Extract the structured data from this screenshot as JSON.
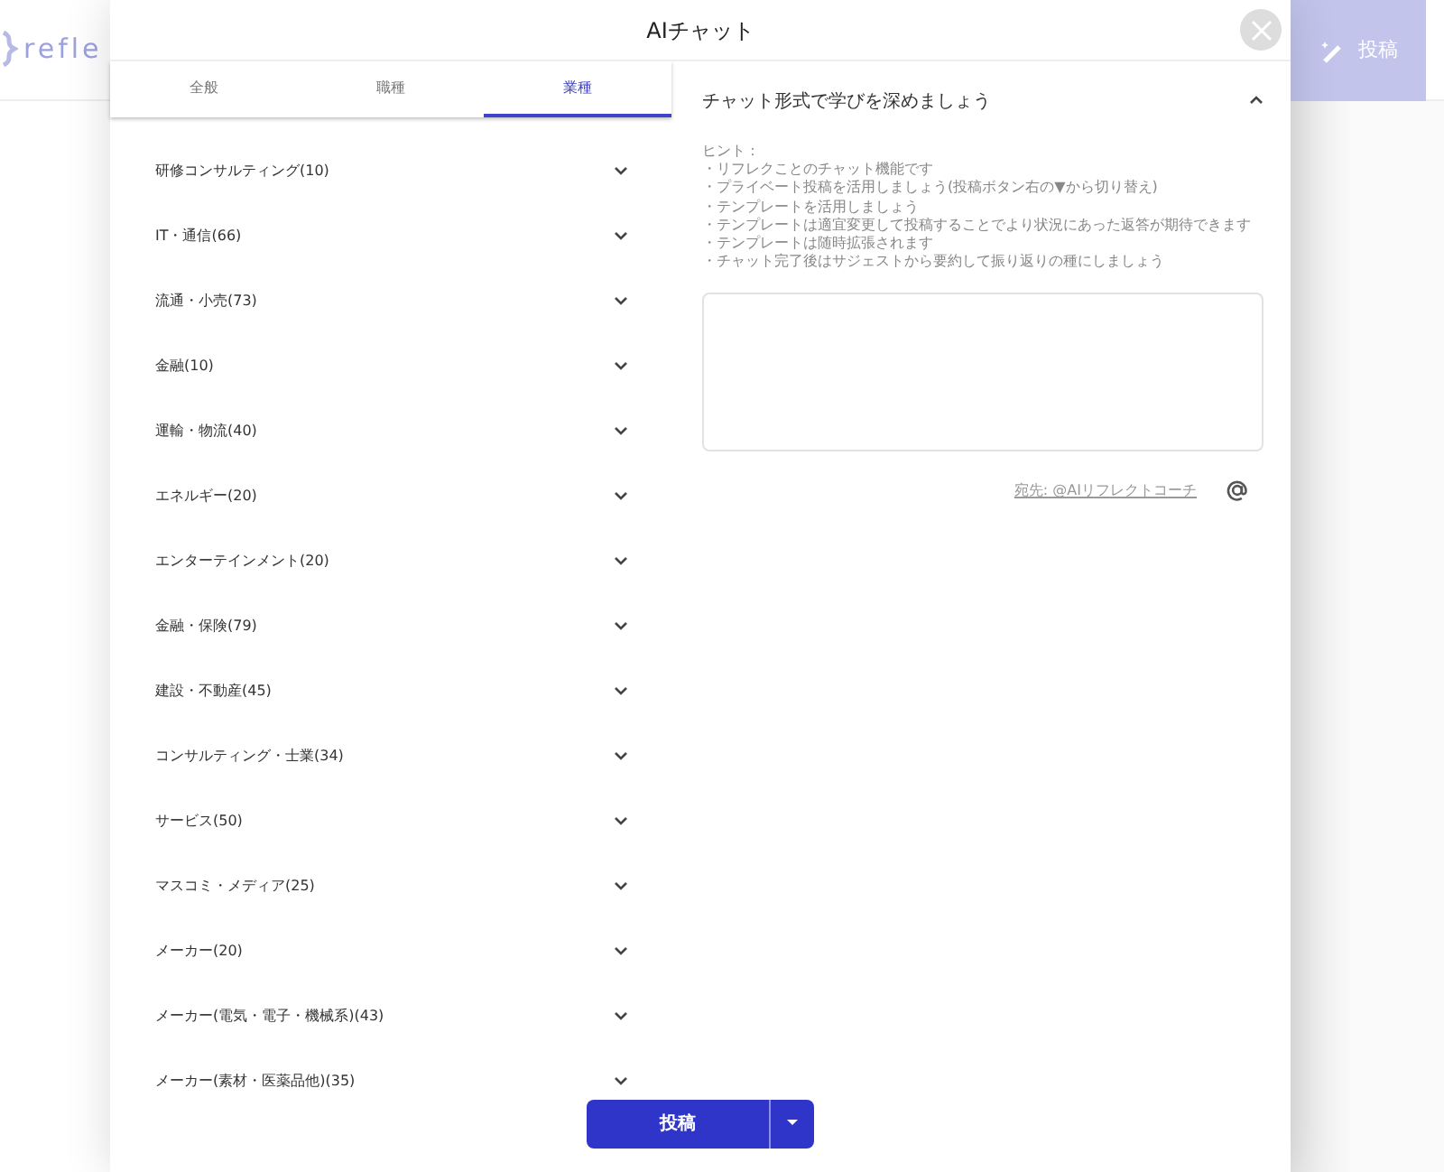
{
  "background": {
    "logo_text": "refle",
    "post_button": "投稿"
  },
  "modal": {
    "title": "AIチャット"
  },
  "tabs": [
    {
      "label": "全般",
      "selected": false
    },
    {
      "label": "職種",
      "selected": false
    },
    {
      "label": "業種",
      "selected": true
    }
  ],
  "categories": [
    {
      "label": "研修コンサルティング(10)",
      "expanded": false
    },
    {
      "label": "IT・通信(66)",
      "expanded": false
    },
    {
      "label": "流通・小売(73)",
      "expanded": false
    },
    {
      "label": "金融(10)",
      "expanded": false
    },
    {
      "label": "運輸・物流(40)",
      "expanded": false
    },
    {
      "label": "エネルギー(20)",
      "expanded": false
    },
    {
      "label": "エンターテインメント(20)",
      "expanded": false
    },
    {
      "label": "金融・保険(79)",
      "expanded": false
    },
    {
      "label": "建設・不動産(45)",
      "expanded": false
    },
    {
      "label": "コンサルティング・士業(34)",
      "expanded": false
    },
    {
      "label": "サービス(50)",
      "expanded": false
    },
    {
      "label": "マスコミ・メディア(25)",
      "expanded": false
    },
    {
      "label": "メーカー(20)",
      "expanded": false
    },
    {
      "label": "メーカー(電気・電子・機械系)(43)",
      "expanded": false
    },
    {
      "label": "メーカー(素材・医薬品他)(35)",
      "expanded": false
    }
  ],
  "hint_panel": {
    "title": "チャット形式で学びを深めましょう",
    "expanded": true,
    "heading": "ヒント：",
    "lines": [
      "・リフレクことのチャット機能です",
      "・プライベート投稿を活用しましょう(投稿ボタン右の▼から切り替え)",
      "・テンプレートを活用しましょう",
      "・テンプレートは適宜変更して投稿することでより状況にあった返答が期待できます",
      "・テンプレートは随時拡張されます",
      "・チャット完了後はサジェストから要約して振り返りの種にしましょう"
    ]
  },
  "recipient": "宛先: @AIリフレクトコーチ",
  "submit_button": "投稿"
}
